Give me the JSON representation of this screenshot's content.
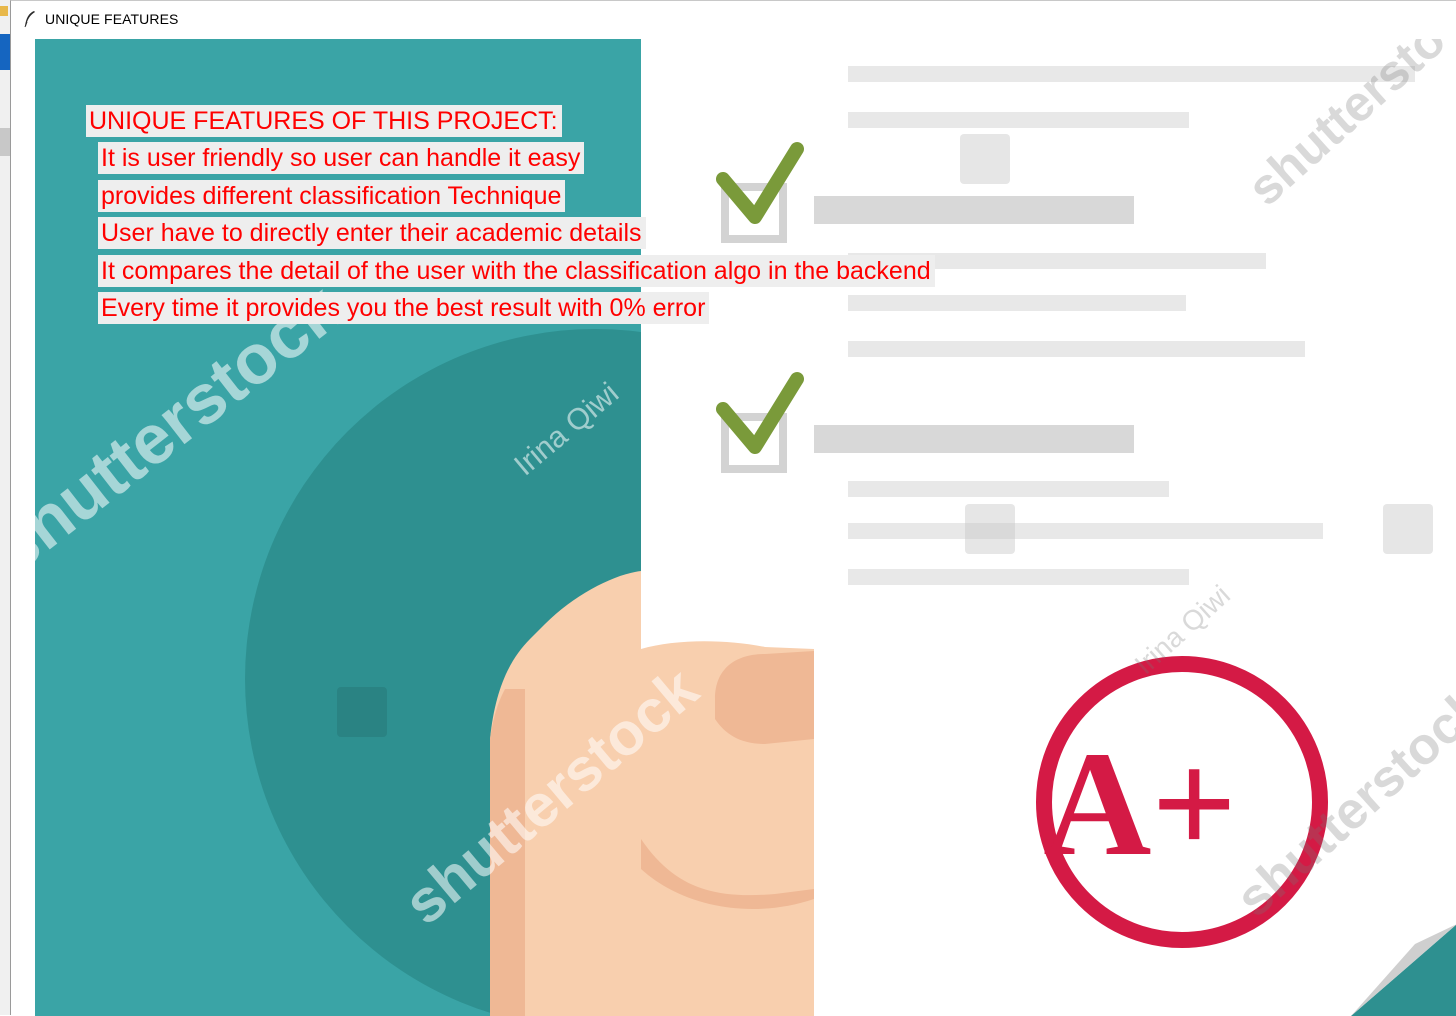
{
  "window": {
    "title": "UNIQUE FEATURES",
    "icon": "feather-icon"
  },
  "features": {
    "heading": "UNIQUE FEATURES OF THIS PROJECT:",
    "items": [
      "It is user friendly so user can handle it easy",
      "provides different classification Technique",
      "User have to directly enter their academic details",
      "It compares the detail of the user with the classification algo in the backend",
      "Every time it provides you the best result with 0% error"
    ],
    "text_color": "#ff0000",
    "highlight_color": "#eeeeee"
  },
  "background_image": {
    "grade": "A+",
    "watermarks": [
      "shutterstock",
      "shutterstock",
      "shutterstock",
      "shutterstock",
      "shutterst"
    ],
    "author_marks": [
      "Irina Qiwi",
      "Irina Qiwi"
    ],
    "colors": {
      "teal": "#2f9595",
      "teal_dark": "#2b8a8a",
      "check_green": "#7a9a3a",
      "grade_red": "#d41a45",
      "skin": "#f8cfae",
      "line_grey": "#e6e6e6"
    }
  }
}
